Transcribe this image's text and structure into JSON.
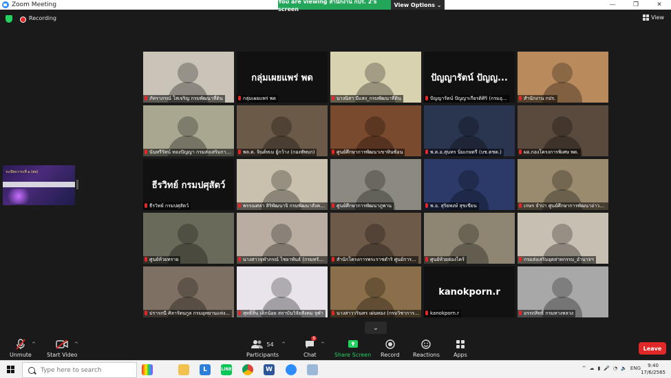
{
  "window": {
    "title": "Zoom Meeting",
    "minimize": "—",
    "restore": "❐",
    "close": "✕"
  },
  "banner": {
    "viewing": "You are viewing สำนักงาน กปร. 2's screen",
    "view_options": "View Options ⌄"
  },
  "status": {
    "recording": "Recording",
    "view": "View"
  },
  "tiles": [
    {
      "name": "ภัทราภรณ์ โสเจริญ กรมพัฒนาที่ดิน",
      "big": "",
      "bg": "#c9c3b8"
    },
    {
      "name": "กลุ่มเผยแพร่ พด",
      "big": "กลุ่มเผยแพร่ พด",
      "bg": "#111111"
    },
    {
      "name": "นางนิสา มีแสง_กรมพัฒนาที่ดิน",
      "big": "",
      "bg": "#d9d2b0"
    },
    {
      "name": "ปัญญารัตน์ ปัญญาเกียรติศิริ (กรมอุ...",
      "big": "ปัญญารัตน์ ปัญญ...",
      "bg": "#111111"
    },
    {
      "name": "สำนักงาน กปร.",
      "big": "",
      "bg": "#b88a5c"
    },
    {
      "name": "นันทรีรัตน์ ทองปัญญา กรมส่งเสริมการเกษตร",
      "big": "",
      "bg": "#a9a790"
    },
    {
      "name": "พล.ต. จินต์ทเม ยู้กว้าง (กองทัพบก)",
      "big": "",
      "bg": "#6b5a48"
    },
    {
      "name": "ศูนย์ศึกษาการพัฒนาเขาหินซ้อน",
      "big": "",
      "bg": "#7a4a2e"
    },
    {
      "name": "พ.ต.อ.สุนทร นิ่มเกษตรี (บช.ตชด.)",
      "big": "",
      "bg": "#2a3550"
    },
    {
      "name": "ผอ.กองโครงการพิเศษ พด.",
      "big": "",
      "bg": "#5a4a3d"
    },
    {
      "name": "ธีรวิทย์ กรมปศุสัตว์",
      "big": "ธีรวิทย์ กรมปศุสัตว์",
      "bg": "#111111"
    },
    {
      "name": "พรรณศลา สิริพัฒนาจิ กรมพัฒนาสังคม...",
      "big": "",
      "bg": "#c9c0ad"
    },
    {
      "name": "ศูนย์ศึกษาการพัฒนาภูพาน",
      "big": "",
      "bg": "#8c8a80"
    },
    {
      "name": "พ.อ. สุริยพงษ์ สุขเขียน",
      "big": "",
      "bg": "#2b3a68"
    },
    {
      "name": "เกษร จำปา ศูนย์ศึกษาการพัฒนาอ่าวคุ้งกระเบน...",
      "big": "",
      "bg": "#9a8a6e"
    },
    {
      "name": "ศูนย์ห้วยทราย",
      "big": "",
      "bg": "#6a6a5a"
    },
    {
      "name": "นางสาวจุฬาภรณ์ ไชยาพันธ์ (กรมทรัพยากร...)",
      "big": "",
      "bg": "#b8ada0"
    },
    {
      "name": "สำนักโครงการพระราชดำริ ศูนย์การ...",
      "big": "",
      "bg": "#6e5a48"
    },
    {
      "name": "ศูนย์ห้วยฮ่องไคร้",
      "big": "",
      "bg": "#8e8672"
    },
    {
      "name": "กรมส่งเสริมอุตสาหกรรม_อำนาจฯ",
      "big": "",
      "bg": "#c7bfb2"
    },
    {
      "name": "ปรารถนี ศิลารัตนกูล กรมอุทยานแห่ง...",
      "big": "",
      "bg": "#7e7062"
    },
    {
      "name": "สุทธิ์สิ้น เด็กน้อย สถาบันวิจัยสังคม จุฬา",
      "big": "",
      "bg": "#e9e4ec"
    },
    {
      "name": "นางสาววรินทร เผ่นทอง (กรมวิชาการ...)",
      "big": "",
      "bg": "#8b6f4a"
    },
    {
      "name": "kanokporn.r",
      "big": "kanokporn.r",
      "bg": "#111111"
    },
    {
      "name": "อรรถสิทธิ์ กรมทางหลวง",
      "big": "",
      "bg": "#a8a8a8"
    }
  ],
  "sideshare": {
    "title": "ระเบียบวาระที่ ๑ (ต่อ)"
  },
  "toolbar": {
    "unmute": "Unmute",
    "start_video": "Start Video",
    "participants": "Participants",
    "participants_count": "54",
    "chat": "Chat",
    "chat_badge": "6",
    "share": "Share Screen",
    "record": "Record",
    "reactions": "Reactions",
    "apps": "Apps",
    "leave": "Leave"
  },
  "taskbar": {
    "search_placeholder": "Type here to search",
    "lang": "ENG",
    "time": "9:40",
    "date": "17/6/2565"
  }
}
